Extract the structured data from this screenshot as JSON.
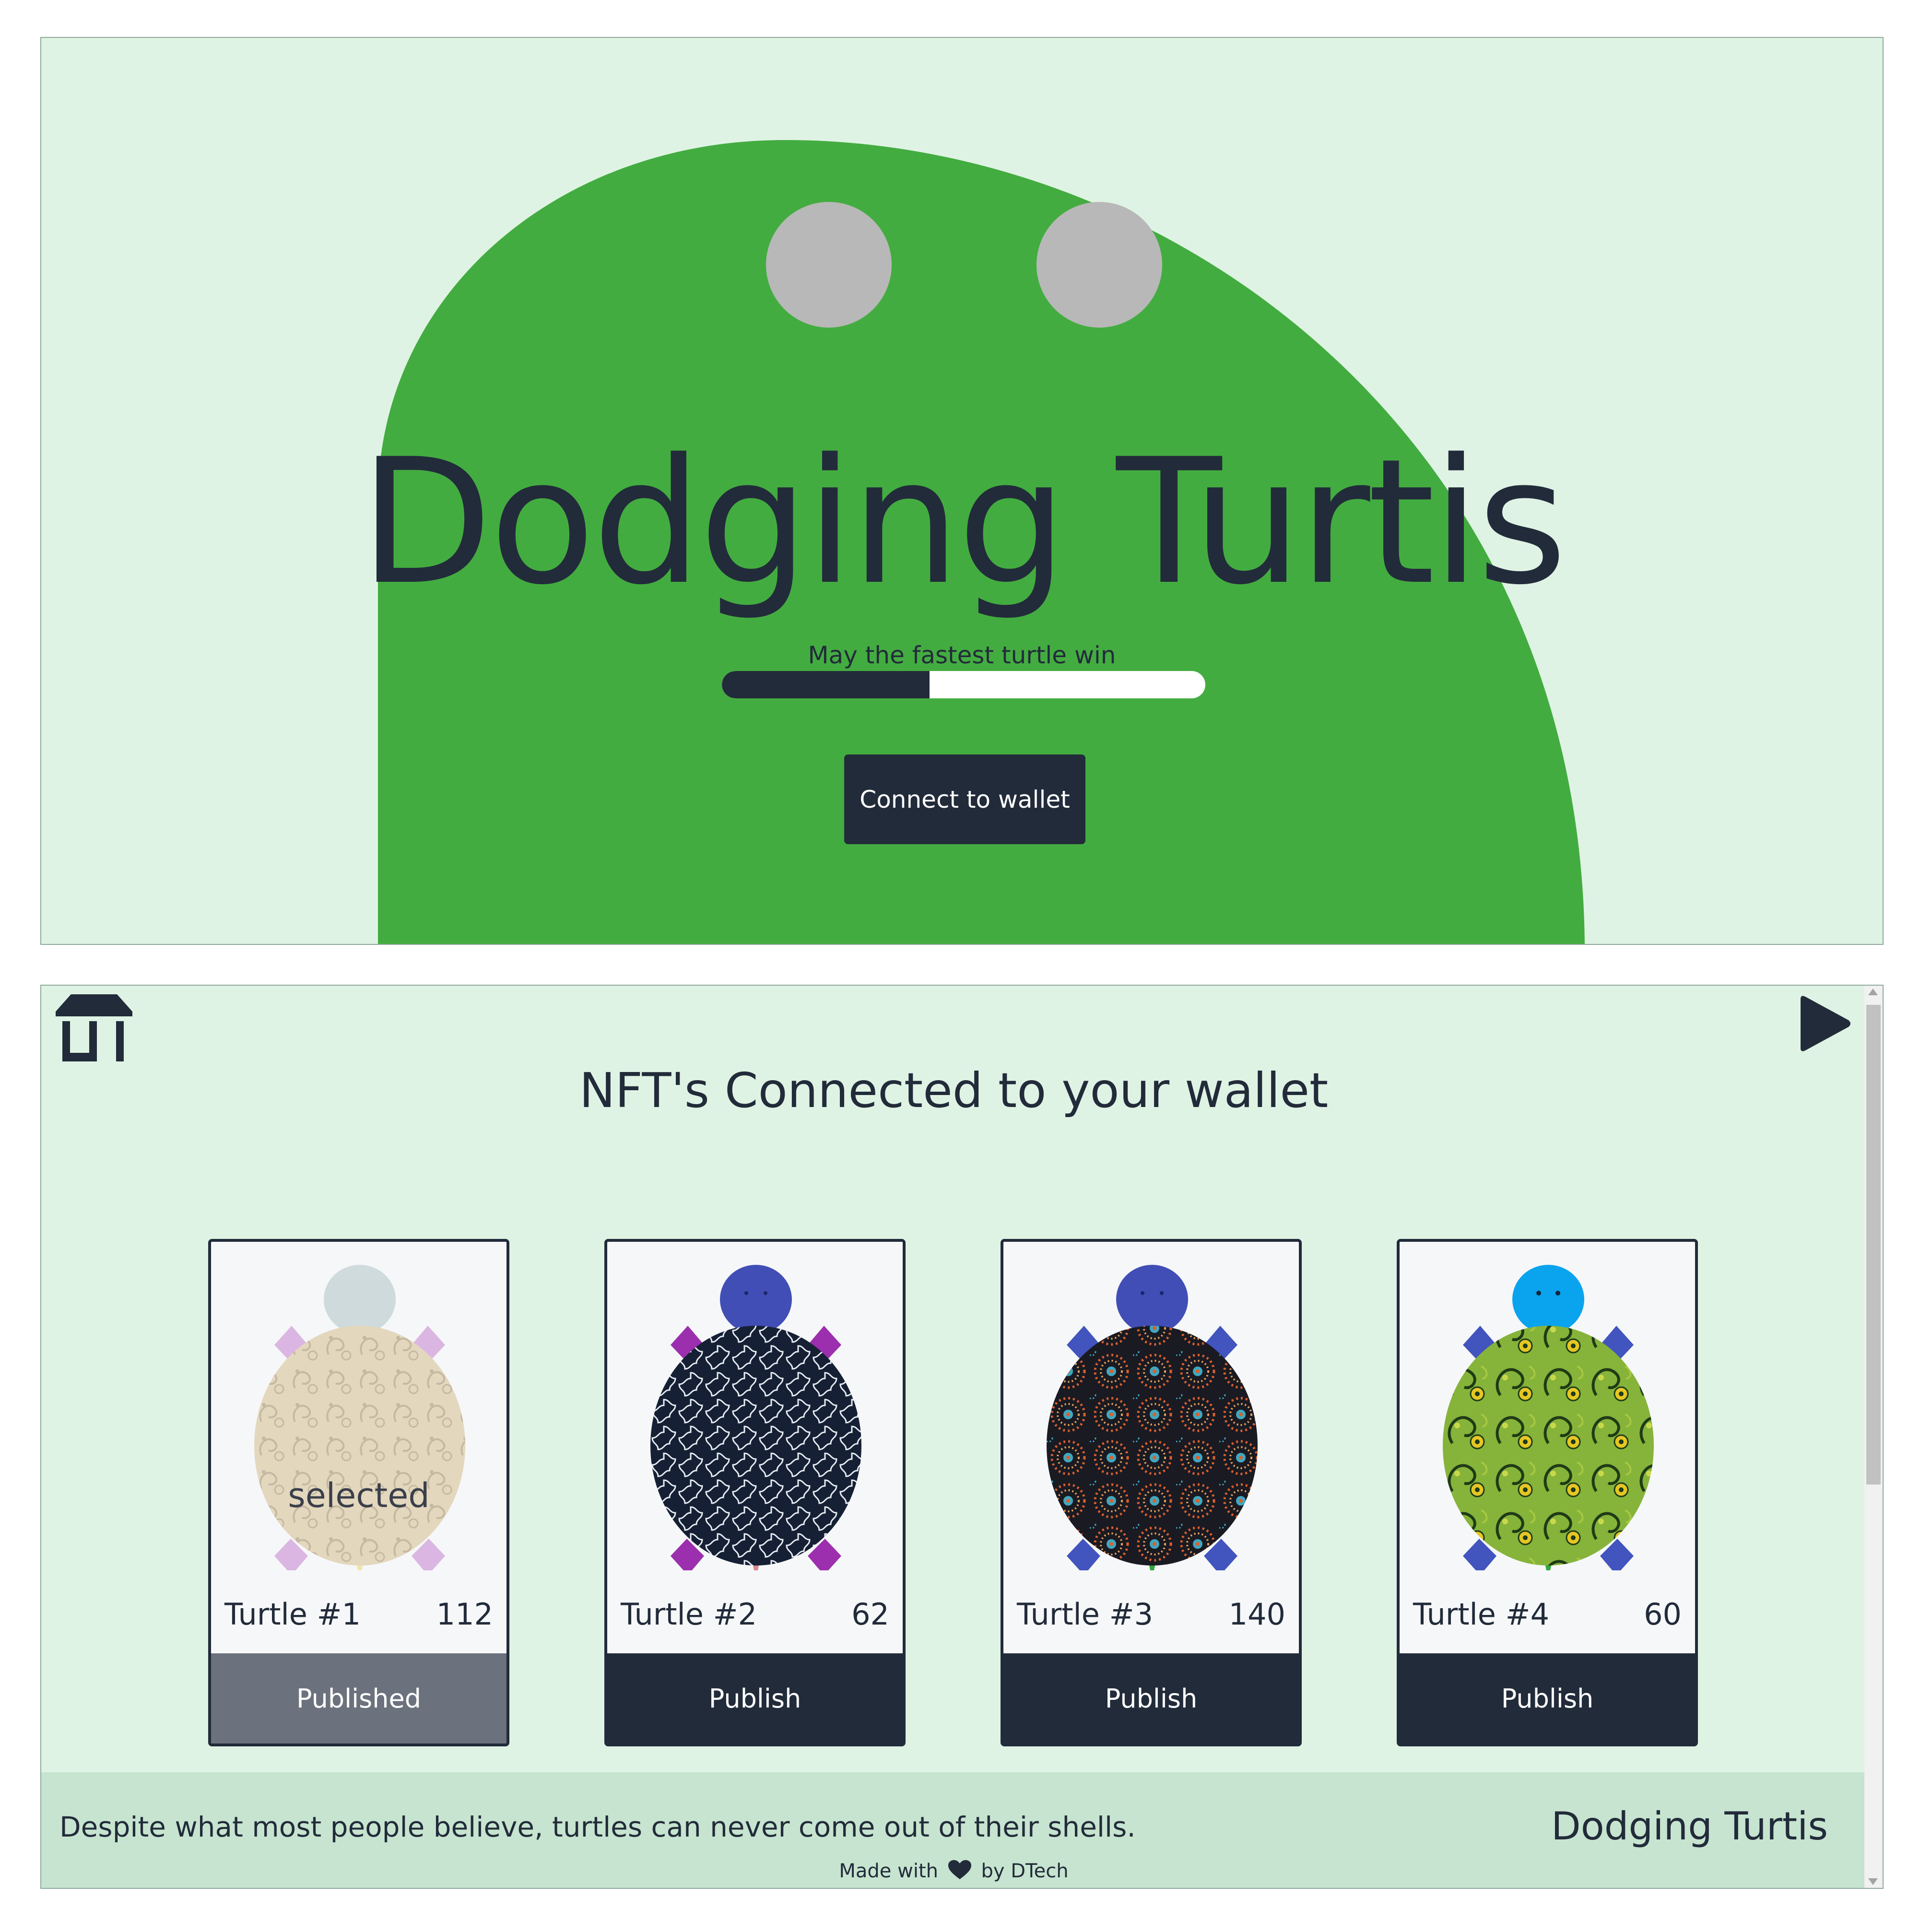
{
  "hero": {
    "title": "Dodging Turtis",
    "subtitle": "May the fastest turtle win",
    "progress": 0.43,
    "connect_label": "Connect to wallet"
  },
  "icons": {
    "store": "store-icon",
    "play": "play-icon",
    "heart": "heart-icon"
  },
  "nft": {
    "section_title": "NFT's Connected to your wallet",
    "cards": [
      {
        "name": "Turtle #1",
        "score": "112",
        "button": "Published",
        "selected": "selected"
      },
      {
        "name": "Turtle #2",
        "score": "62",
        "button": "Publish"
      },
      {
        "name": "Turtle #3",
        "score": "140",
        "button": "Publish"
      },
      {
        "name": "Turtle #4",
        "score": "60",
        "button": "Publish"
      }
    ]
  },
  "footer": {
    "quote": "Despite what most people believe, turtles can never come out of their shells.",
    "brand": "Dodging Turtis",
    "made_prefix": "Made with",
    "made_suffix": "by DTech"
  },
  "colors": {
    "background": "#dff3e4",
    "blob_green": "#43ac40",
    "eye_gray": "#b8b8b8",
    "navy": "#222b3a",
    "published_gray": "#6c727d",
    "footer_bg": "#c6e4cf"
  }
}
